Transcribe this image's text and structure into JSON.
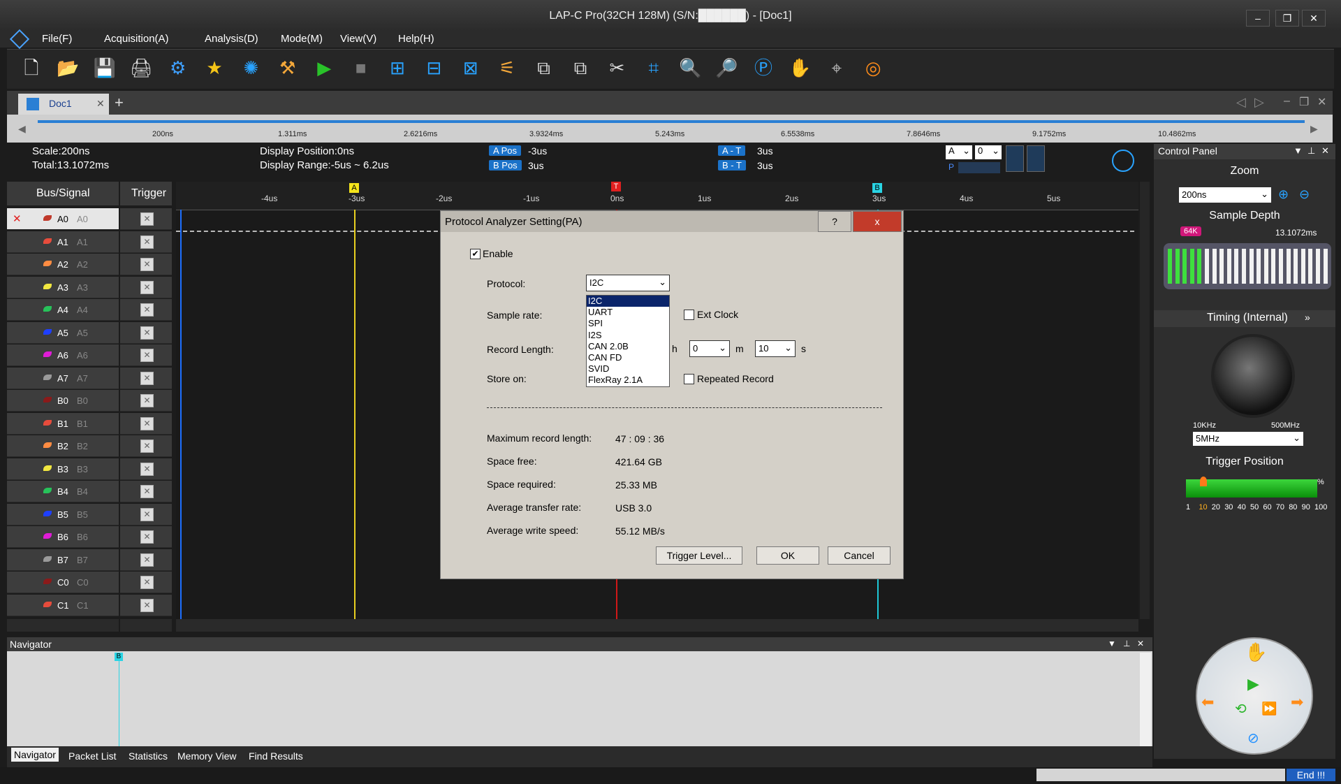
{
  "window": {
    "title": "LAP-C Pro(32CH 128M) (S/N:██████) - [Doc1]",
    "minimize": "–",
    "restore": "❐",
    "close": "✕"
  },
  "menu": [
    "File(F)",
    "Acquisition(A)",
    "Analysis(D)",
    "Mode(M)",
    "View(V)",
    "Help(H)"
  ],
  "toolbar_icons": [
    "new-doc-icon",
    "open-folder-icon",
    "save-icon",
    "print-icon",
    "save-settings-icon",
    "favorite-star-icon",
    "network-icon",
    "tools-icon",
    "run-icon",
    "stop-icon",
    "add-cursor-icon",
    "cursor-icon",
    "cursor2-icon",
    "probe-icon",
    "copy-icon",
    "paste-icon",
    "cut-icon",
    "counter-icon",
    "zoom-in-icon",
    "zoom-out-icon",
    "zoom-fit-icon",
    "hand-icon",
    "measure-icon",
    "help-lifebuoy-icon"
  ],
  "tabs": {
    "doc": "Doc1",
    "add": "+"
  },
  "timeline": {
    "ticks": [
      "200ns",
      "1.311ms",
      "2.6216ms",
      "3.9324ms",
      "5.243ms",
      "6.5538ms",
      "7.8646ms",
      "9.1752ms",
      "10.4862ms"
    ]
  },
  "info": {
    "scale": "Scale:200ns",
    "total": "Total:13.1072ms",
    "display_position": "Display Position:0ns",
    "display_range": "Display Range:-5us ~ 6.2us",
    "a_pos_label": "A Pos",
    "a_pos_value": "-3us",
    "b_pos_label": "B Pos",
    "b_pos_value": "3us",
    "a_t_label": "A - T",
    "a_t_value": "3us",
    "b_t_label": "B - T",
    "b_t_value": "3us",
    "sel_a": "A",
    "sel_num": "0",
    "p_label": "P"
  },
  "signal_panel": {
    "bus_header": "Bus/Signal",
    "trigger_header": "Trigger",
    "signals": [
      {
        "name": "A0",
        "alias": "A0",
        "color": "#c0392b"
      },
      {
        "name": "A1",
        "alias": "A1",
        "color": "#e74c3c"
      },
      {
        "name": "A2",
        "alias": "A2",
        "color": "#ff8c42"
      },
      {
        "name": "A3",
        "alias": "A3",
        "color": "#f1e740"
      },
      {
        "name": "A4",
        "alias": "A4",
        "color": "#27c25a"
      },
      {
        "name": "A5",
        "alias": "A5",
        "color": "#1e3fff"
      },
      {
        "name": "A6",
        "alias": "A6",
        "color": "#e01cd8"
      },
      {
        "name": "A7",
        "alias": "A7",
        "color": "#9a9a9a"
      },
      {
        "name": "B0",
        "alias": "B0",
        "color": "#8b1a1a"
      },
      {
        "name": "B1",
        "alias": "B1",
        "color": "#e74c3c"
      },
      {
        "name": "B2",
        "alias": "B2",
        "color": "#ff8c42"
      },
      {
        "name": "B3",
        "alias": "B3",
        "color": "#f1e740"
      },
      {
        "name": "B4",
        "alias": "B4",
        "color": "#27c25a"
      },
      {
        "name": "B5",
        "alias": "B5",
        "color": "#1e3fff"
      },
      {
        "name": "B6",
        "alias": "B6",
        "color": "#e01cd8"
      },
      {
        "name": "B7",
        "alias": "B7",
        "color": "#9a9a9a"
      },
      {
        "name": "C0",
        "alias": "C0",
        "color": "#8b1a1a"
      },
      {
        "name": "C1",
        "alias": "C1",
        "color": "#e74c3c"
      }
    ]
  },
  "wave_ruler": {
    "labels": [
      "-4us",
      "-3us",
      "-2us",
      "-1us",
      "0ns",
      "1us",
      "2us",
      "3us",
      "4us",
      "5us"
    ],
    "markers": {
      "a": "A",
      "t": "T",
      "b": "B"
    }
  },
  "dialog": {
    "title": "Protocol Analyzer Setting(PA)",
    "help": "?",
    "close": "x",
    "enable_label": "Enable",
    "protocol_label": "Protocol:",
    "protocol_value": "I2C",
    "protocol_options": [
      "I2C",
      "UART",
      "SPI",
      "I2S",
      "CAN 2.0B",
      "CAN FD",
      "SVID",
      "FlexRay 2.1A"
    ],
    "sample_rate_label": "Sample rate:",
    "ext_clock_label": "Ext Clock",
    "record_length_label": "Record Length:",
    "h_label": "h",
    "m_value": "0",
    "m_label": "m",
    "s_value": "10",
    "s_label": "s",
    "store_on_label": "Store on:",
    "repeated_record_label": "Repeated Record",
    "stats": [
      {
        "label": "Maximum record length:",
        "value": "47 : 09 : 36"
      },
      {
        "label": "Space free:",
        "value": "421.64 GB"
      },
      {
        "label": "Space required:",
        "value": "25.33 MB"
      },
      {
        "label": "Average transfer rate:",
        "value": "USB 3.0"
      },
      {
        "label": "Average write speed:",
        "value": "55.12 MB/s"
      }
    ],
    "trigger_level_button": "Trigger Level...",
    "ok_button": "OK",
    "cancel_button": "Cancel"
  },
  "control_panel": {
    "title": "Control Panel",
    "zoom_header": "Zoom",
    "zoom_value": "200ns",
    "sample_depth_header": "Sample Depth",
    "depth_badge": "64K",
    "depth_total": "13.1072ms",
    "timing_header": "Timing (Internal)",
    "freq_min": "10KHz",
    "freq_max": "500MHz",
    "freq_value": "5MHz",
    "trigger_position_header": "Trigger Position",
    "trigger_percent_sign": "%",
    "trigger_scale": [
      "1",
      "10",
      "20",
      "30",
      "40",
      "50",
      "60",
      "70",
      "80",
      "90",
      "100"
    ],
    "trigger_position_value": "10"
  },
  "navigator": {
    "title": "Navigator",
    "marker_b": "B",
    "tabs": [
      "Navigator",
      "Packet List",
      "Statistics",
      "Memory View",
      "Find Results"
    ]
  },
  "status": {
    "end": "End !!!"
  }
}
